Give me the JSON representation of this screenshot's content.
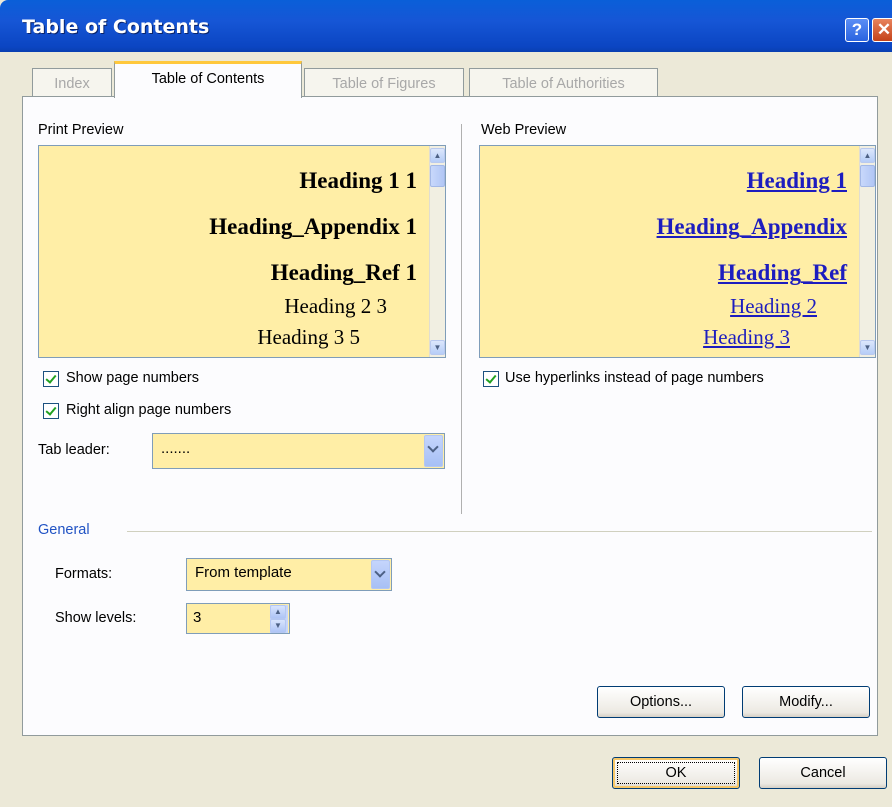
{
  "window": {
    "title": "Table of Contents"
  },
  "tabs": [
    {
      "label": "Index",
      "active": false
    },
    {
      "label": "Table of Contents",
      "active": true
    },
    {
      "label": "Table of Figures",
      "active": false
    },
    {
      "label": "Table of Authorities",
      "active": false
    }
  ],
  "print_preview": {
    "label": "Print Preview",
    "lines": [
      {
        "text": "Heading 1 1"
      },
      {
        "text": "Heading_Appendix 1"
      },
      {
        "text": "Heading_Ref 1"
      },
      {
        "text": "Heading 2 3"
      },
      {
        "text": "Heading 3 5"
      }
    ]
  },
  "web_preview": {
    "label": "Web Preview",
    "lines": [
      {
        "text": "Heading 1"
      },
      {
        "text": "Heading_Appendix"
      },
      {
        "text": "Heading_Ref"
      },
      {
        "text": "Heading 2"
      },
      {
        "text": "Heading 3"
      }
    ]
  },
  "options": {
    "show_page_numbers": {
      "label": "Show page numbers",
      "checked": true
    },
    "right_align": {
      "label": "Right align page numbers",
      "checked": true
    },
    "use_hyperlinks": {
      "label": "Use hyperlinks instead of page numbers",
      "checked": true
    },
    "tab_leader": {
      "label": "Tab leader:",
      "value": "......."
    }
  },
  "general": {
    "group_label": "General",
    "formats": {
      "label": "Formats:",
      "value": "From template"
    },
    "show_levels": {
      "label": "Show levels:",
      "value": "3"
    }
  },
  "buttons": {
    "options": "Options...",
    "modify": "Modify...",
    "ok": "OK",
    "cancel": "Cancel"
  }
}
